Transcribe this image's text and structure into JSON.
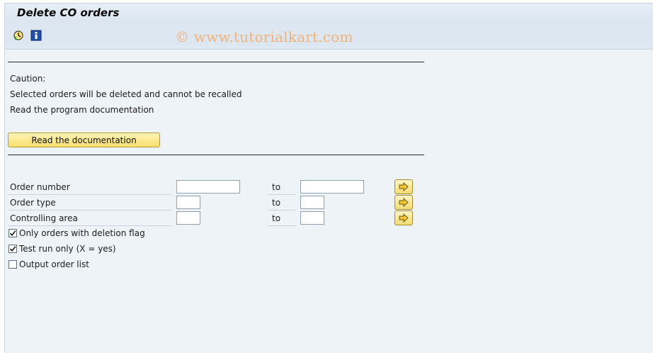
{
  "window": {
    "title": "Delete CO orders"
  },
  "toolbar": {
    "execute_icon": "execute-clock-icon",
    "info_icon": "information-icon"
  },
  "watermark": "© www.tutorialkart.com",
  "caution": {
    "line1": "Caution:",
    "line2": "Selected orders will be deleted and cannot be recalled",
    "line3": "Read the program documentation"
  },
  "doc_button": {
    "label": "Read the documentation"
  },
  "selection": {
    "to_label": "to",
    "rows": [
      {
        "label": "Order number",
        "from": "",
        "to": ""
      },
      {
        "label": "Order type",
        "from": "",
        "to": ""
      },
      {
        "label": "Controlling area",
        "from": "",
        "to": ""
      }
    ]
  },
  "options": [
    {
      "label": "Only orders with deletion flag",
      "checked": true
    },
    {
      "label": "Test run only (X = yes)",
      "checked": true
    },
    {
      "label": "Output order list",
      "checked": false
    }
  ],
  "colors": {
    "button_yellow": "#f8df6c",
    "background": "#eef3f8",
    "watermark": "#f0b27a"
  }
}
